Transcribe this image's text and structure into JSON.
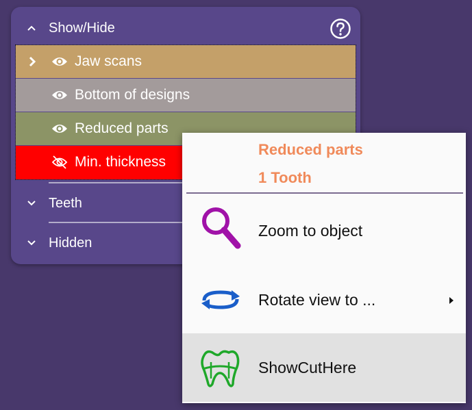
{
  "colors": {
    "background": "#48386b",
    "panel": "#58478a",
    "row_jaw_scans": "#c4a069",
    "row_bottom_of_designs": "#a39b9b",
    "row_reduced_parts": "#8c9466",
    "row_min_thickness": "#ff0000",
    "menu_title": "#f08a5a",
    "zoom_icon": "#a012a8",
    "rotate_icon": "#1a5ec9",
    "cut_icon": "#1fa82a"
  },
  "panel": {
    "header": {
      "label": "Show/Hide",
      "icon": "chevron-up-icon",
      "help_icon": "help-circle-icon"
    },
    "items": [
      {
        "label": "Jaw scans",
        "icon": "eye-icon",
        "expandable": true
      },
      {
        "label": "Bottom of designs",
        "icon": "eye-icon",
        "expandable": false
      },
      {
        "label": "Reduced parts",
        "icon": "eye-icon",
        "expandable": false
      },
      {
        "label": "Min. thickness",
        "icon": "eye-off-icon",
        "expandable": false
      }
    ],
    "sections": [
      {
        "label": "Teeth",
        "icon": "chevron-down-icon"
      },
      {
        "label": "Hidden",
        "icon": "chevron-down-icon"
      }
    ]
  },
  "context_menu": {
    "title": "Reduced parts",
    "subtitle": "1 Tooth",
    "items": [
      {
        "label": "Zoom to object",
        "icon": "magnifier-icon",
        "has_submenu": false
      },
      {
        "label": "Rotate view to ...",
        "icon": "rotate-icon",
        "has_submenu": true
      },
      {
        "label": "ShowCutHere",
        "icon": "tooth-cut-icon",
        "has_submenu": false,
        "highlighted": true
      }
    ]
  }
}
